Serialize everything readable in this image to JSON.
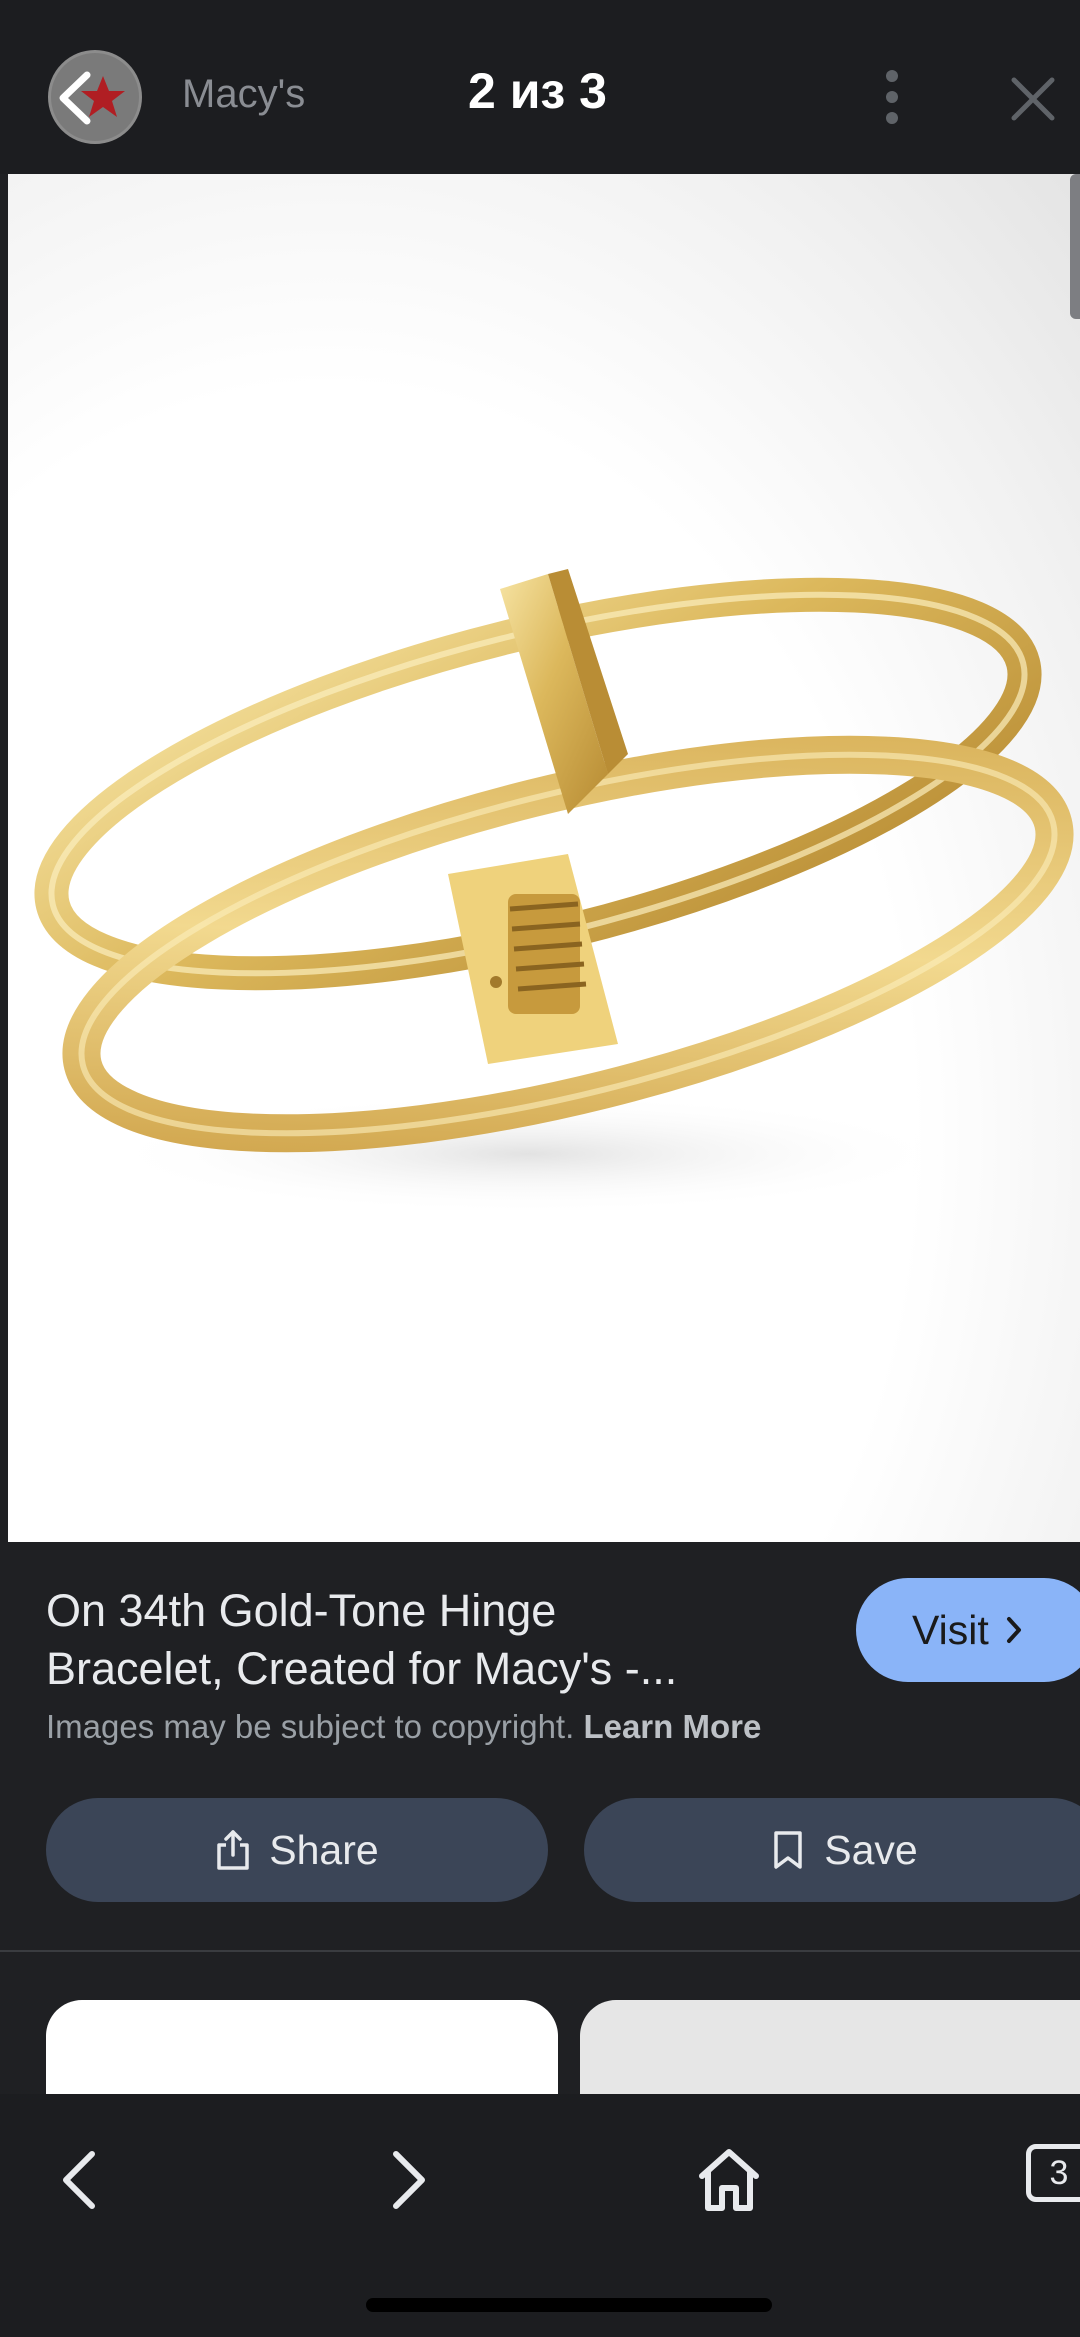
{
  "header": {
    "site_name": "Macy's",
    "counter": "2 из 3"
  },
  "result": {
    "title_line1": "On 34th Gold-Tone Hinge",
    "title_line2": "Bracelet, Created for Macy's -...",
    "visit_label": "Visit",
    "copyright_text": "Images may be subject to copyright.",
    "learn_more": "Learn More",
    "share_label": "Share",
    "save_label": "Save"
  },
  "bottom_nav": {
    "tab_count": "3"
  },
  "colors": {
    "accent": "#8ab4f8",
    "action_button": "#3b4557",
    "background": "#1f2023",
    "gold": "#e3c46e"
  },
  "icons": [
    "back-arrow-icon",
    "star-logo-icon",
    "more-vert-icon",
    "close-icon",
    "chevron-right-icon",
    "share-icon",
    "bookmark-icon",
    "nav-back-icon",
    "nav-forward-icon",
    "home-icon",
    "tabs-icon"
  ]
}
